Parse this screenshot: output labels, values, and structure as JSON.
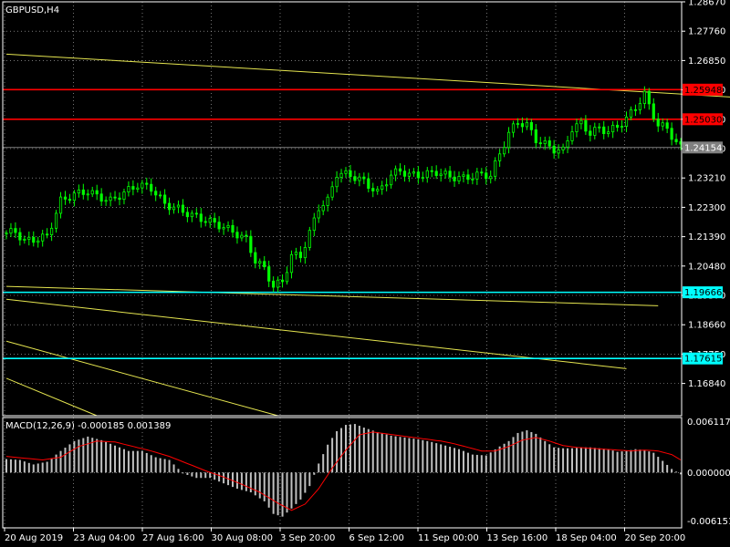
{
  "chart_data": [
    {
      "type": "candlestick",
      "title": "GBPUSD,H4",
      "ylim": [
        1.1584,
        1.2867
      ],
      "yticks": [
        1.2867,
        1.2776,
        1.2685,
        1.2594,
        1.2503,
        1.2412,
        1.2321,
        1.223,
        1.2139,
        1.2048,
        1.1957,
        1.1866,
        1.1775,
        1.1684
      ],
      "ytick_labels": [
        "1.28670",
        "1.27760",
        "1.26850",
        "1.25940",
        "1.25030",
        "1.24120",
        "1.23210",
        "1.22300",
        "1.21390",
        "1.20480",
        "1.19570",
        "1.18660",
        "1.17750",
        "1.16840"
      ],
      "xtick_labels": [
        "20 Aug 2019",
        "23 Aug 04:00",
        "27 Aug 16:00",
        "30 Aug 08:00",
        "3 Sep 20:00",
        "6 Sep 12:00",
        "11 Sep 00:00",
        "13 Sep 16:00",
        "18 Sep 04:00",
        "20 Sep 20:00"
      ],
      "grid": true,
      "price_levels": [
        {
          "value": 1.25948,
          "label": "1.25948",
          "kind": "resistance"
        },
        {
          "value": 1.2503,
          "label": "1.25030",
          "kind": "resistance"
        },
        {
          "value": 1.24154,
          "label": "1.24154",
          "kind": "current"
        },
        {
          "value": 1.19666,
          "label": "1.19666",
          "kind": "support"
        },
        {
          "value": 1.17615,
          "label": "1.17615",
          "kind": "support"
        }
      ],
      "trendlines": [
        {
          "from": [
            0,
            1.2705
          ],
          "to": [
            172,
            1.2562
          ]
        },
        {
          "from": [
            0,
            1.1985
          ],
          "to": [
            144,
            1.1925
          ]
        },
        {
          "from": [
            0,
            1.1945
          ],
          "to": [
            137,
            1.173
          ]
        },
        {
          "from": [
            0,
            1.1815
          ],
          "to": [
            60,
            1.1584
          ]
        },
        {
          "from": [
            0,
            1.17
          ],
          "to": [
            20,
            1.1584
          ]
        }
      ],
      "close_path": [
        [
          0,
          1.215
        ],
        [
          2,
          1.2155
        ],
        [
          4,
          1.2125
        ],
        [
          6,
          1.213
        ],
        [
          9,
          1.214
        ],
        [
          12,
          1.225
        ],
        [
          15,
          1.227
        ],
        [
          18,
          1.228
        ],
        [
          20,
          1.2265
        ],
        [
          23,
          1.225
        ],
        [
          26,
          1.2275
        ],
        [
          29,
          1.23
        ],
        [
          32,
          1.229
        ],
        [
          35,
          1.224
        ],
        [
          38,
          1.2225
        ],
        [
          41,
          1.2205
        ],
        [
          44,
          1.219
        ],
        [
          47,
          1.2175
        ],
        [
          50,
          1.2155
        ],
        [
          53,
          1.213
        ],
        [
          55,
          1.2065
        ],
        [
          57,
          1.204
        ],
        [
          59,
          1.1985
        ],
        [
          61,
          1.2
        ],
        [
          63,
          1.208
        ],
        [
          65,
          1.208
        ],
        [
          67,
          1.215
        ],
        [
          69,
          1.223
        ],
        [
          71,
          1.225
        ],
        [
          73,
          1.2335
        ],
        [
          76,
          1.233
        ],
        [
          79,
          1.231
        ],
        [
          82,
          1.2275
        ],
        [
          85,
          1.233
        ],
        [
          87,
          1.2345
        ],
        [
          89,
          1.233
        ],
        [
          92,
          1.233
        ],
        [
          95,
          1.234
        ],
        [
          98,
          1.2325
        ],
        [
          101,
          1.232
        ],
        [
          104,
          1.233
        ],
        [
          107,
          1.233
        ],
        [
          109,
          1.2395
        ],
        [
          111,
          1.246
        ],
        [
          113,
          1.2495
        ],
        [
          115,
          1.2485
        ],
        [
          117,
          1.244
        ],
        [
          119,
          1.2425
        ],
        [
          121,
          1.241
        ],
        [
          123,
          1.2405
        ],
        [
          125,
          1.2475
        ],
        [
          127,
          1.249
        ],
        [
          129,
          1.246
        ],
        [
          131,
          1.2475
        ],
        [
          133,
          1.2465
        ],
        [
          135,
          1.248
        ],
        [
          137,
          1.2505
        ],
        [
          139,
          1.254
        ],
        [
          141,
          1.258
        ],
        [
          142,
          1.2545
        ],
        [
          144,
          1.2485
        ],
        [
          146,
          1.2475
        ],
        [
          148,
          1.243
        ],
        [
          149,
          1.2415
        ]
      ]
    },
    {
      "type": "bar",
      "title": "MACD(12,26,9) -0.000185 0.001389",
      "ylim": [
        -0.006151,
        0.006117
      ],
      "yticks": [
        0.006117,
        0.0,
        -0.006151
      ],
      "ytick_labels": [
        "0.006117",
        "0.000000",
        "-0.006151"
      ],
      "histogram_path": [
        [
          0,
          0.0015
        ],
        [
          3,
          0.0014
        ],
        [
          6,
          0.0009
        ],
        [
          9,
          0.0012
        ],
        [
          12,
          0.0024
        ],
        [
          15,
          0.0035
        ],
        [
          18,
          0.004
        ],
        [
          21,
          0.0036
        ],
        [
          24,
          0.003
        ],
        [
          27,
          0.0024
        ],
        [
          30,
          0.0024
        ],
        [
          33,
          0.0017
        ],
        [
          36,
          0.0014
        ],
        [
          39,
          -0.0001
        ],
        [
          42,
          -0.0006
        ],
        [
          45,
          -0.0006
        ],
        [
          48,
          -0.0012
        ],
        [
          51,
          -0.0018
        ],
        [
          54,
          -0.0022
        ],
        [
          57,
          -0.0032
        ],
        [
          59,
          -0.0046
        ],
        [
          61,
          -0.0049
        ],
        [
          63,
          -0.004
        ],
        [
          65,
          -0.003
        ],
        [
          67,
          -0.0015
        ],
        [
          69,
          0.001
        ],
        [
          71,
          0.0031
        ],
        [
          73,
          0.0046
        ],
        [
          75,
          0.0053
        ],
        [
          77,
          0.0054
        ],
        [
          79,
          0.005
        ],
        [
          82,
          0.0045
        ],
        [
          85,
          0.0041
        ],
        [
          88,
          0.0039
        ],
        [
          91,
          0.0037
        ],
        [
          94,
          0.0034
        ],
        [
          97,
          0.003
        ],
        [
          100,
          0.0026
        ],
        [
          103,
          0.002
        ],
        [
          106,
          0.0019
        ],
        [
          109,
          0.0029
        ],
        [
          111,
          0.0035
        ],
        [
          113,
          0.0044
        ],
        [
          115,
          0.0047
        ],
        [
          117,
          0.0043
        ],
        [
          119,
          0.0035
        ],
        [
          121,
          0.0028
        ],
        [
          123,
          0.0027
        ],
        [
          125,
          0.0027
        ],
        [
          127,
          0.0028
        ],
        [
          129,
          0.0028
        ],
        [
          131,
          0.0027
        ],
        [
          133,
          0.0026
        ],
        [
          135,
          0.0023
        ],
        [
          137,
          0.0024
        ],
        [
          139,
          0.0026
        ],
        [
          141,
          0.0025
        ],
        [
          143,
          0.0022
        ],
        [
          145,
          0.0013
        ],
        [
          147,
          0.0004
        ],
        [
          149,
          -0.0002
        ]
      ],
      "signal_path": [
        [
          0,
          0.0018
        ],
        [
          4,
          0.0016
        ],
        [
          8,
          0.0014
        ],
        [
          12,
          0.0017
        ],
        [
          16,
          0.0029
        ],
        [
          20,
          0.0035
        ],
        [
          24,
          0.0034
        ],
        [
          28,
          0.0029
        ],
        [
          32,
          0.0024
        ],
        [
          36,
          0.0018
        ],
        [
          40,
          0.001
        ],
        [
          44,
          0.0002
        ],
        [
          48,
          -0.0005
        ],
        [
          52,
          -0.0013
        ],
        [
          56,
          -0.0022
        ],
        [
          60,
          -0.0034
        ],
        [
          63,
          -0.0042
        ],
        [
          66,
          -0.0035
        ],
        [
          69,
          -0.0018
        ],
        [
          72,
          0.0005
        ],
        [
          75,
          0.0025
        ],
        [
          78,
          0.0042
        ],
        [
          81,
          0.0045
        ],
        [
          84,
          0.0043
        ],
        [
          87,
          0.0041
        ],
        [
          90,
          0.0039
        ],
        [
          93,
          0.0037
        ],
        [
          96,
          0.0035
        ],
        [
          99,
          0.0032
        ],
        [
          102,
          0.0028
        ],
        [
          105,
          0.0024
        ],
        [
          108,
          0.0024
        ],
        [
          111,
          0.0029
        ],
        [
          114,
          0.0036
        ],
        [
          117,
          0.0039
        ],
        [
          120,
          0.0035
        ],
        [
          123,
          0.003
        ],
        [
          126,
          0.0028
        ],
        [
          129,
          0.0027
        ],
        [
          132,
          0.0026
        ],
        [
          135,
          0.0025
        ],
        [
          138,
          0.0024
        ],
        [
          141,
          0.0025
        ],
        [
          144,
          0.0024
        ],
        [
          147,
          0.002
        ],
        [
          149,
          0.0014
        ]
      ]
    }
  ],
  "colors": {
    "background": "#000000",
    "grid": "#c0c0c0",
    "bull_candle": "#00ff00",
    "trendline": "#e6e650",
    "resistance": "#ff0000",
    "support": "#00ffff",
    "current_price": "#808080",
    "histogram": "#c0c0c0",
    "signal": "#ff0000",
    "text": "#ffffff"
  }
}
